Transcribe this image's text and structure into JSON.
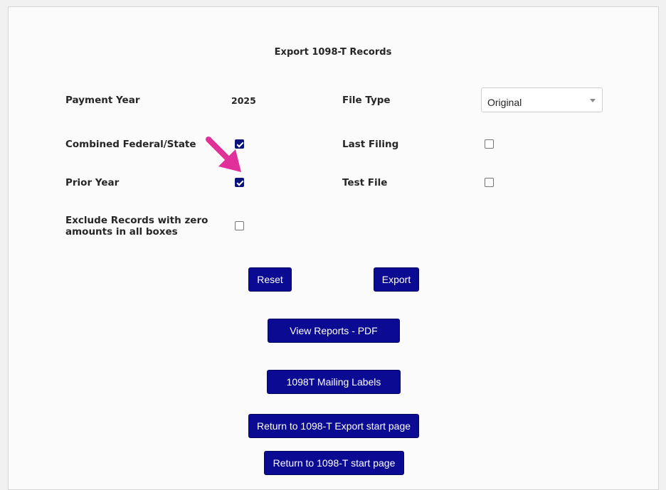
{
  "page": {
    "title": "Export 1098-T Records"
  },
  "form": {
    "payment_year_label": "Payment Year",
    "payment_year_value": "2025",
    "file_type_label": "File Type",
    "file_type_value": "Original",
    "combined_label": "Combined Federal/State",
    "combined_checked": true,
    "last_filing_label": "Last Filing",
    "last_filing_checked": false,
    "prior_year_label": "Prior Year",
    "prior_year_checked": true,
    "test_file_label": "Test File",
    "test_file_checked": false,
    "exclude_zero_label_line1": "Exclude Records with zero",
    "exclude_zero_label_line2": "amounts in all boxes",
    "exclude_zero_checked": false
  },
  "buttons": {
    "reset": "Reset",
    "export": "Export",
    "view_reports": "View Reports - PDF",
    "mailing_labels": "1098T Mailing Labels",
    "return_export_start": "Return to 1098-T Export start page",
    "return_start": "Return to 1098-T start page"
  },
  "colors": {
    "button_bg": "#0b0a93",
    "checkbox_checked": "#0b137a",
    "annotation_arrow": "#e0309a"
  },
  "icons": {
    "annotation": "pointer-arrow-icon",
    "dropdown": "chevron-down-icon"
  }
}
